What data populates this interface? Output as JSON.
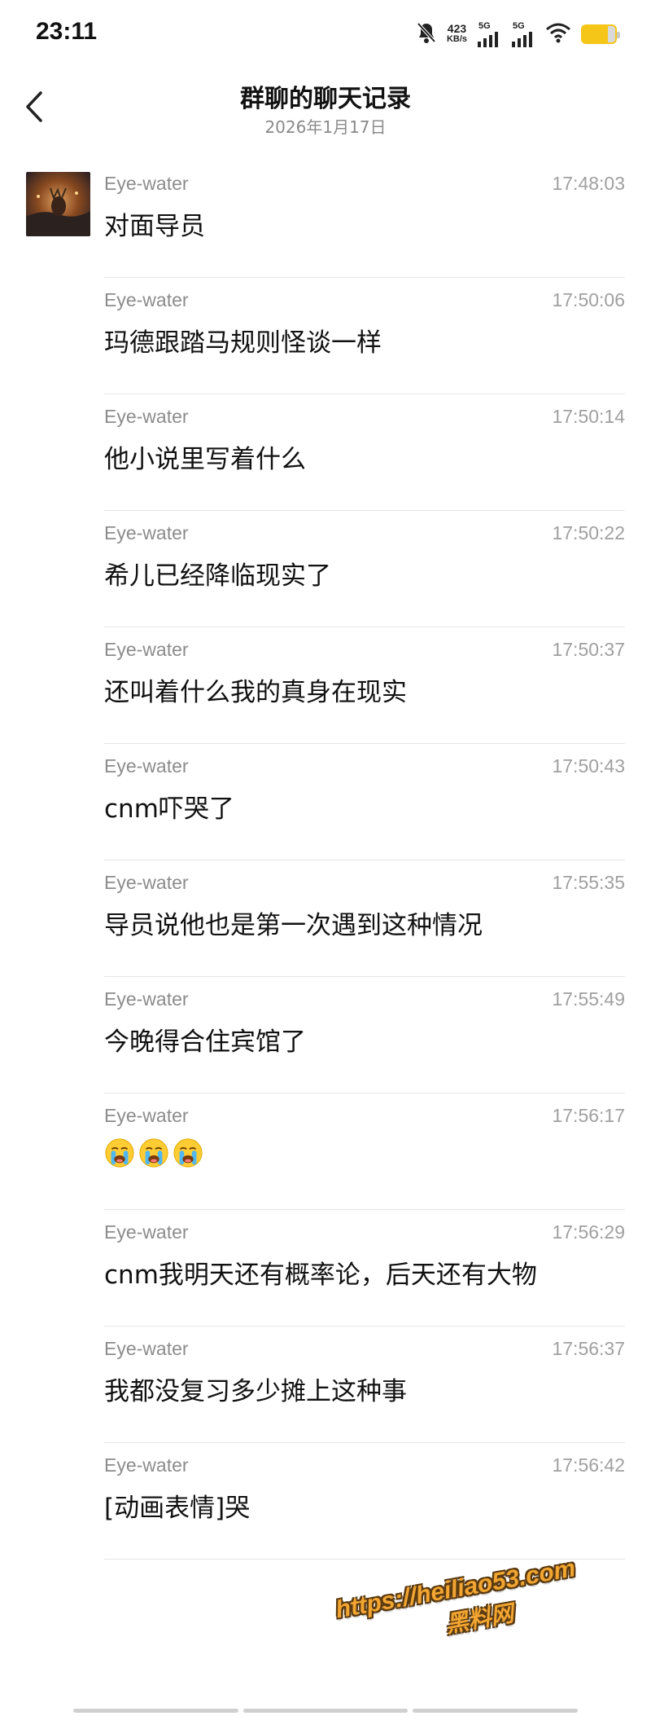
{
  "status_bar": {
    "time": "23:11",
    "net_speed_value": "423",
    "net_speed_unit": "KB/s",
    "signal1_label": "5G",
    "signal2_label": "5G",
    "battery_color": "#f5c518"
  },
  "header": {
    "title": "群聊的聊天记录",
    "date": "2026年1月17日"
  },
  "messages": [
    {
      "sender": "Eye-water",
      "time": "17:48:03",
      "text": "对面导员"
    },
    {
      "sender": "Eye-water",
      "time": "17:50:06",
      "text": "玛德跟踏马规则怪谈一样"
    },
    {
      "sender": "Eye-water",
      "time": "17:50:14",
      "text": "他小说里写着什么"
    },
    {
      "sender": "Eye-water",
      "time": "17:50:22",
      "text": "希儿已经降临现实了"
    },
    {
      "sender": "Eye-water",
      "time": "17:50:37",
      "text": "还叫着什么我的真身在现实"
    },
    {
      "sender": "Eye-water",
      "time": "17:50:43",
      "text": "cnm吓哭了"
    },
    {
      "sender": "Eye-water",
      "time": "17:55:35",
      "text": "导员说他也是第一次遇到这种情况"
    },
    {
      "sender": "Eye-water",
      "time": "17:55:49",
      "text": "今晚得合住宾馆了"
    },
    {
      "sender": "Eye-water",
      "time": "17:56:17",
      "emoji": "crying-face-emoji x3"
    },
    {
      "sender": "Eye-water",
      "time": "17:56:29",
      "text": "cnm我明天还有概率论，后天还有大物"
    },
    {
      "sender": "Eye-water",
      "time": "17:56:37",
      "text": "我都没复习多少摊上这种事"
    },
    {
      "sender": "Eye-water",
      "time": "17:56:42",
      "text": "[动画表情]哭"
    }
  ],
  "watermark": {
    "url": "https://heiliao53.com",
    "name": "黑料网"
  }
}
